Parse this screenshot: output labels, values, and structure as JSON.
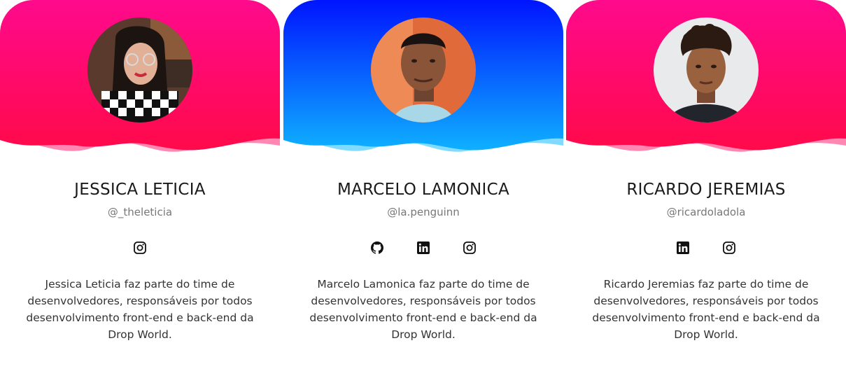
{
  "members": [
    {
      "name": "JESSICA LETICIA",
      "handle": "@_theleticia",
      "description": "Jessica Leticia faz parte do time de desenvolvedores, responsáveis por todos desenvolvimento front-end e back-end da Drop World.",
      "theme": {
        "top": "#ff0a8c",
        "bottom": "#ff0a4a",
        "wave": "#ff5f97"
      },
      "avatar": "profile-photo-jessica",
      "socials": [
        "instagram-icon"
      ]
    },
    {
      "name": "MARCELO LAMONICA",
      "handle": "@la.penguinn",
      "description": "Marcelo Lamonica faz parte do time de desenvolvedores, responsáveis por todos desenvolvimento front-end e back-end da Drop World.",
      "theme": {
        "top": "#0014ff",
        "bottom": "#0fb0ff",
        "wave": "#62d2ff"
      },
      "avatar": "profile-photo-marcelo",
      "socials": [
        "github-icon",
        "linkedin-icon",
        "instagram-icon"
      ]
    },
    {
      "name": "RICARDO JEREMIAS",
      "handle": "@ricardoladola",
      "description": "Ricardo Jeremias faz parte do time de desenvolvedores, responsáveis por todos desenvolvimento front-end e back-end da Drop World.",
      "theme": {
        "top": "#ff0a8c",
        "bottom": "#ff0a4a",
        "wave": "#ff5f97"
      },
      "avatar": "profile-photo-ricardo",
      "socials": [
        "linkedin-icon",
        "instagram-icon"
      ]
    }
  ]
}
